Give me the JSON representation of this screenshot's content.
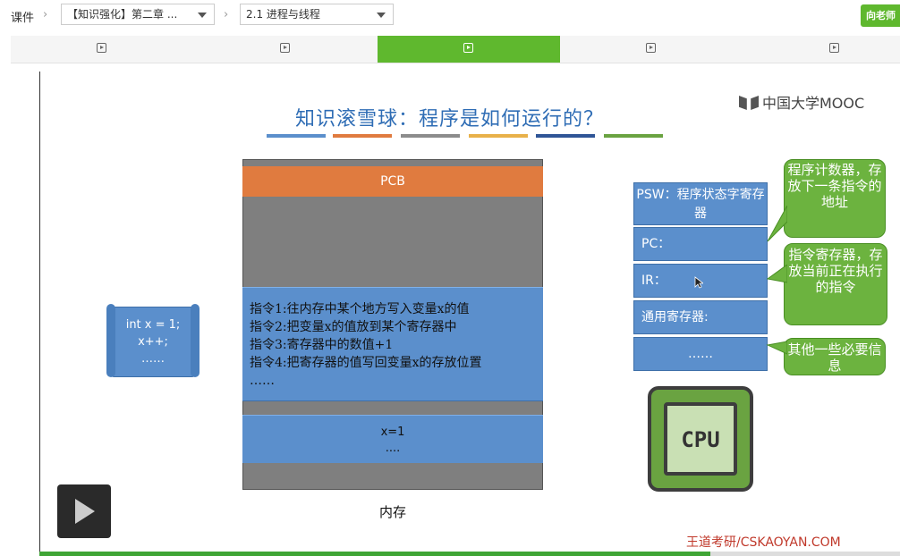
{
  "breadcrumb": {
    "root": "课件",
    "chapter_select": "【知识强化】第二章 ...",
    "section_select": "2.1 进程与线程"
  },
  "ask_button": "向老师",
  "tabs": [
    {
      "icon": "video-play-icon",
      "active": false
    },
    {
      "icon": "video-play-icon",
      "active": false
    },
    {
      "icon": "video-play-icon",
      "active": true
    },
    {
      "icon": "video-play-icon",
      "active": false
    },
    {
      "icon": "video-play-icon",
      "active": false
    }
  ],
  "slide": {
    "title": "知识滚雪球：程序是如何运行的？",
    "underline_colors": [
      "#5b8fcc",
      "#e07b3f",
      "#8c8c8c",
      "#e8b14a",
      "#2f5597",
      "#6aa341"
    ],
    "mooc_logo": "中国大学MOOC",
    "program_scroll": {
      "lines": [
        "int x = 1;",
        "x++;",
        "……"
      ]
    },
    "memory": {
      "pcb": "PCB",
      "instructions": [
        "指令1:往内存中某个地方写入变量x的值",
        "指令2:把变量x的值放到某个寄存器中",
        "指令3:寄存器中的数值+1",
        "指令4:把寄存器的值写回变量x的存放位置",
        "……"
      ],
      "data_lines": [
        "x=1",
        "...."
      ],
      "label": "内存"
    },
    "registers": [
      "PSW：程序状态字寄存器",
      "PC：",
      "IR：",
      "通用寄存器:",
      "……"
    ],
    "callouts": [
      "程序计数器，存放下一条指令的地址",
      "指令寄存器，存放当前正在执行的指令",
      "其他一些必要信息"
    ],
    "cpu_label": "CPU",
    "footer_logo": "王道考研/CSKAOYAN.COM"
  },
  "player": {
    "progress": 0.78
  },
  "colors": {
    "accent_green": "#5fb82e",
    "register_blue": "#5b8fcc",
    "callout_green": "#6cb33f",
    "pcb_orange": "#e07b3f"
  }
}
